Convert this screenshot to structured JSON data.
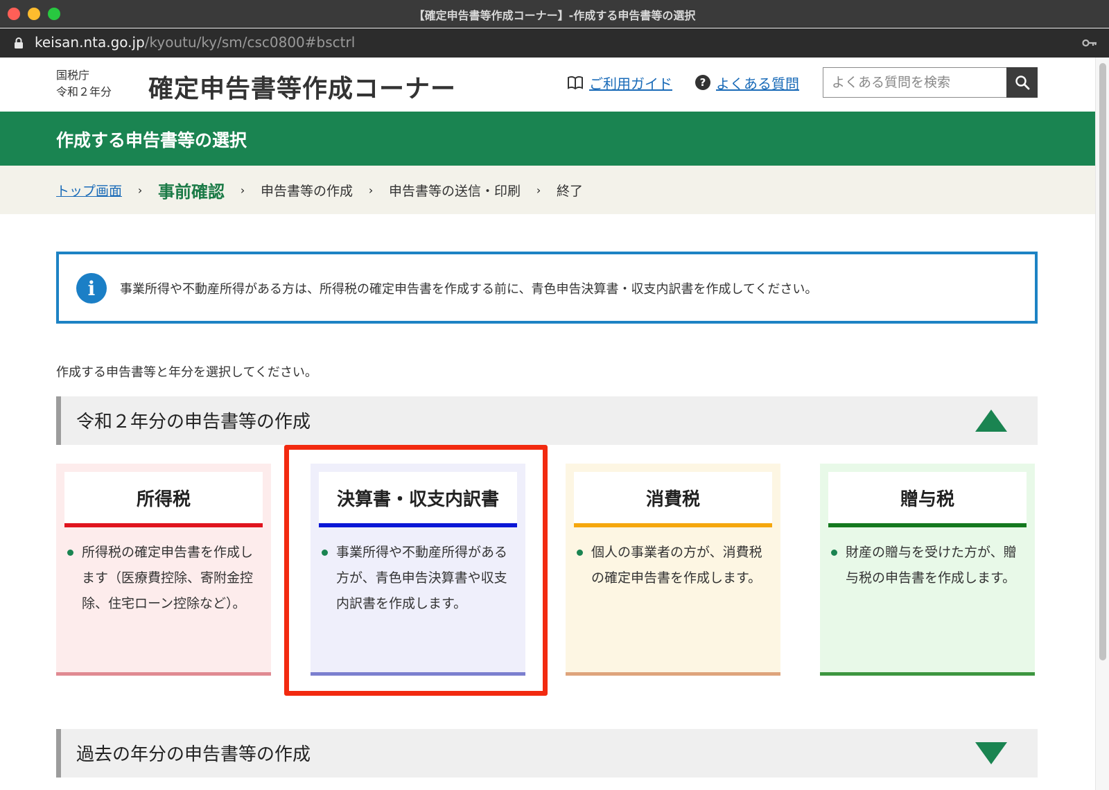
{
  "window": {
    "title": "【確定申告書等作成コーナー】-作成する申告書等の選択",
    "url_host": "keisan.nta.go.jp",
    "url_path": "/kyoutu/ky/sm/csc0800#bsctrl"
  },
  "header": {
    "agency": "国税庁",
    "year": "令和２年分",
    "site_title": "確定申告書等作成コーナー",
    "guide_link": "ご利用ガイド",
    "faq_link": "よくある質問",
    "search_placeholder": "よくある質問を検索"
  },
  "page_title": "作成する申告書等の選択",
  "breadcrumb": {
    "items": [
      "トップ画面",
      "事前確認",
      "申告書等の作成",
      "申告書等の送信・印刷",
      "終了"
    ],
    "separator": "›"
  },
  "notice": {
    "icon_letter": "i",
    "text": "事業所得や不動産所得がある方は、所得税の確定申告書を作成する前に、青色申告決算書・収支内訳書を作成してください。"
  },
  "instruction": "作成する申告書等と年分を選択してください。",
  "sections": [
    {
      "title": "令和２年分の申告書等の作成",
      "expanded": true
    },
    {
      "title": "過去の年分の申告書等の作成",
      "expanded": false
    }
  ],
  "cards": [
    {
      "title": "所得税",
      "description": "所得税の確定申告書を作成します（医療費控除、寄附金控除、住宅ローン控除など）。",
      "bg_color": "#fdecec",
      "accent_color": "#e0141e",
      "bottom_color": "#e08a92"
    },
    {
      "title": "決算書・収支内訳書",
      "description": "事業所得や不動産所得がある方が、青色申告決算書や収支内訳書を作成します。",
      "bg_color": "#efeffb",
      "accent_color": "#0b17d6",
      "bottom_color": "#7b7fcf"
    },
    {
      "title": "消費税",
      "description": "個人の事業者の方が、消費税の確定申告書を作成します。",
      "bg_color": "#fdf6e3",
      "accent_color": "#f5a70e",
      "bottom_color": "#dea47c"
    },
    {
      "title": "贈与税",
      "description": "財産の贈与を受けた方が、贈与税の申告書を作成します。",
      "bg_color": "#e8f9e8",
      "accent_color": "#14791f",
      "bottom_color": "#3d9640"
    }
  ],
  "colors": {
    "brand_green": "#1a8451",
    "link_blue": "#1a6bb8",
    "notice_border": "#1d83c4",
    "highlight_red": "#f22a10"
  }
}
